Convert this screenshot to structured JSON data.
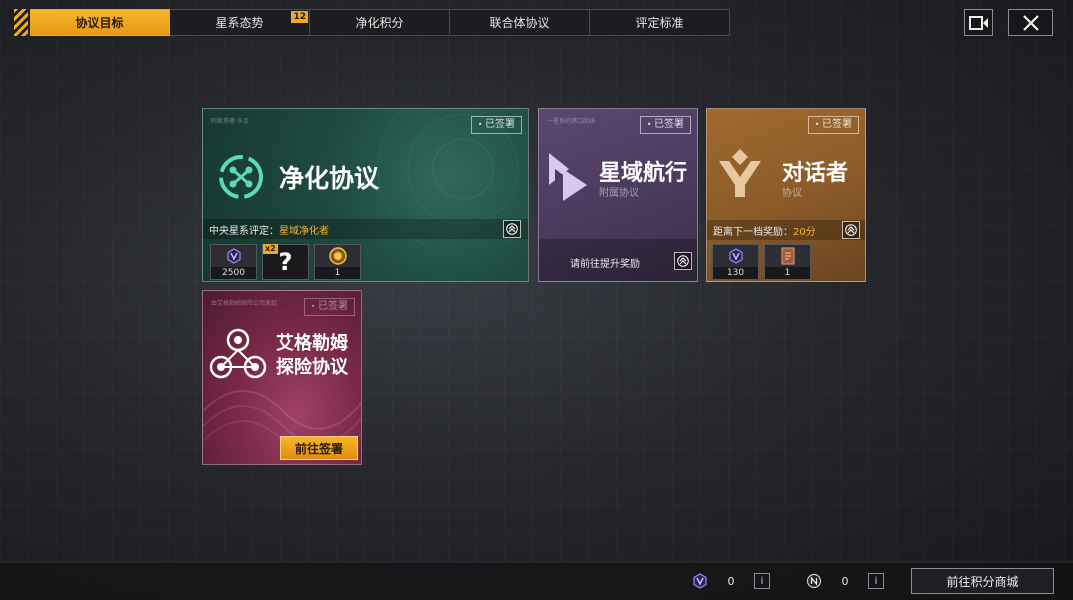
{
  "tabs": [
    {
      "label": "协议目标",
      "active": true,
      "badge": ""
    },
    {
      "label": "星系态势",
      "active": false,
      "badge": "12"
    },
    {
      "label": "净化积分",
      "active": false,
      "badge": ""
    },
    {
      "label": "联合体协议",
      "active": false,
      "badge": ""
    },
    {
      "label": "评定标准",
      "active": false,
      "badge": ""
    }
  ],
  "top_icons": {
    "camera": "video-camera-icon",
    "close": "close-icon"
  },
  "cards": {
    "purify": {
      "title": "净化协议",
      "status": "已签署",
      "tiny_text": "阿斯塔德·多克 ",
      "rating_label": "中央星系评定：",
      "rating_value": "星域净化者",
      "rewards": [
        {
          "icon": "v-token-icon",
          "value": "2500",
          "mult": ""
        },
        {
          "icon": "question-mark-icon",
          "value": "",
          "mult": "x2"
        },
        {
          "icon": "gold-medal-icon",
          "value": "1",
          "mult": ""
        }
      ]
    },
    "star": {
      "title": "星域航行",
      "subtitle": "附属协议",
      "status": "已签署",
      "tiny_text": "一星系的港口航线",
      "action": "请前往提升奖励"
    },
    "dialog": {
      "title": "对话者",
      "subtitle": "协议",
      "status": "已签署",
      "next_label": "距离下一档奖励：",
      "next_value": "20分",
      "rewards": [
        {
          "icon": "v-token-icon",
          "value": "130",
          "mult": ""
        },
        {
          "icon": "document-scroll-icon",
          "value": "1",
          "mult": ""
        }
      ]
    },
    "agram": {
      "title_line1": "艾格勒姆",
      "title_line2": "探险协议",
      "status": "已签署",
      "tiny_text": "由艾格勒姆探险公司发起",
      "button": "前往签署"
    }
  },
  "bottom": {
    "v_currency": "0",
    "n_currency": "0",
    "info": "i",
    "shop_button": "前往积分商城"
  },
  "colors": {
    "accent": "#f0a91d",
    "purify_bg": "#1f4a40",
    "star_bg": "#4a3a5c",
    "dialog_bg": "#8a5a28",
    "agram_bg": "#7a2a48"
  }
}
